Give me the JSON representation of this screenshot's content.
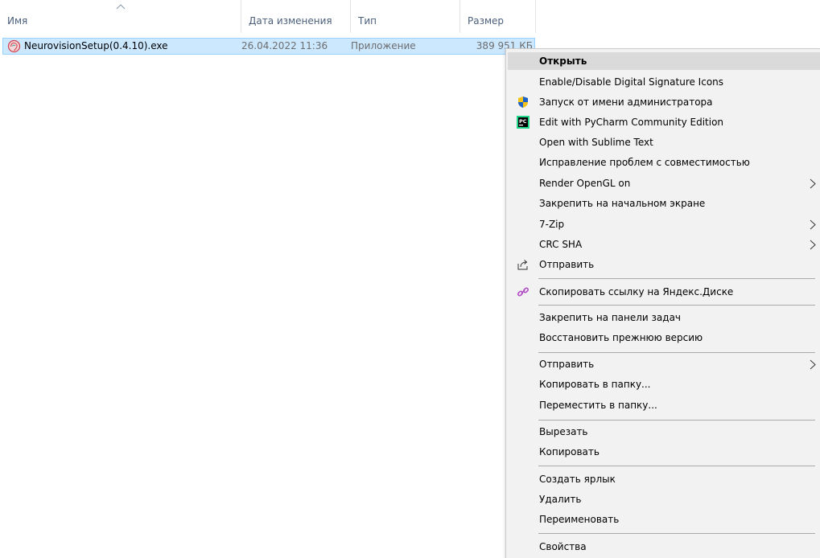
{
  "columns": {
    "name": "Имя",
    "date": "Дата изменения",
    "type": "Тип",
    "size": "Размер"
  },
  "file": {
    "name": "NeurovisionSetup(0.4.10).exe",
    "date": "26.04.2022 11:36",
    "type": "Приложение",
    "size": "389 951 КБ",
    "icon": "neurovision-app-icon"
  },
  "menu": {
    "open": "Открыть",
    "signature_icons": "Enable/Disable Digital Signature Icons",
    "run_as_admin": "Запуск от имени администратора",
    "pycharm": "Edit with PyCharm Community Edition",
    "sublime": "Open with Sublime Text",
    "compat": "Исправление проблем с совместимостью",
    "render_opengl": "Render OpenGL on",
    "pin_start": "Закрепить на начальном экране",
    "sevenzip": "7-Zip",
    "crc_sha": "CRC SHA",
    "share": "Отправить",
    "yandex_link": "Скопировать ссылку на Яндекс.Диске",
    "pin_taskbar": "Закрепить на панели задач",
    "restore_prev": "Восстановить прежнюю версию",
    "send_to": "Отправить",
    "copy_to": "Копировать в папку...",
    "move_to": "Переместить в папку...",
    "cut": "Вырезать",
    "copy": "Копировать",
    "create_shortcut": "Создать ярлык",
    "delete": "Удалить",
    "rename": "Переименовать",
    "properties": "Свойства"
  },
  "colors": {
    "selection": "#cce8ff",
    "menu_bg": "#f2f2f2",
    "menu_hover": "#dadada",
    "header_text": "#4c607a"
  }
}
